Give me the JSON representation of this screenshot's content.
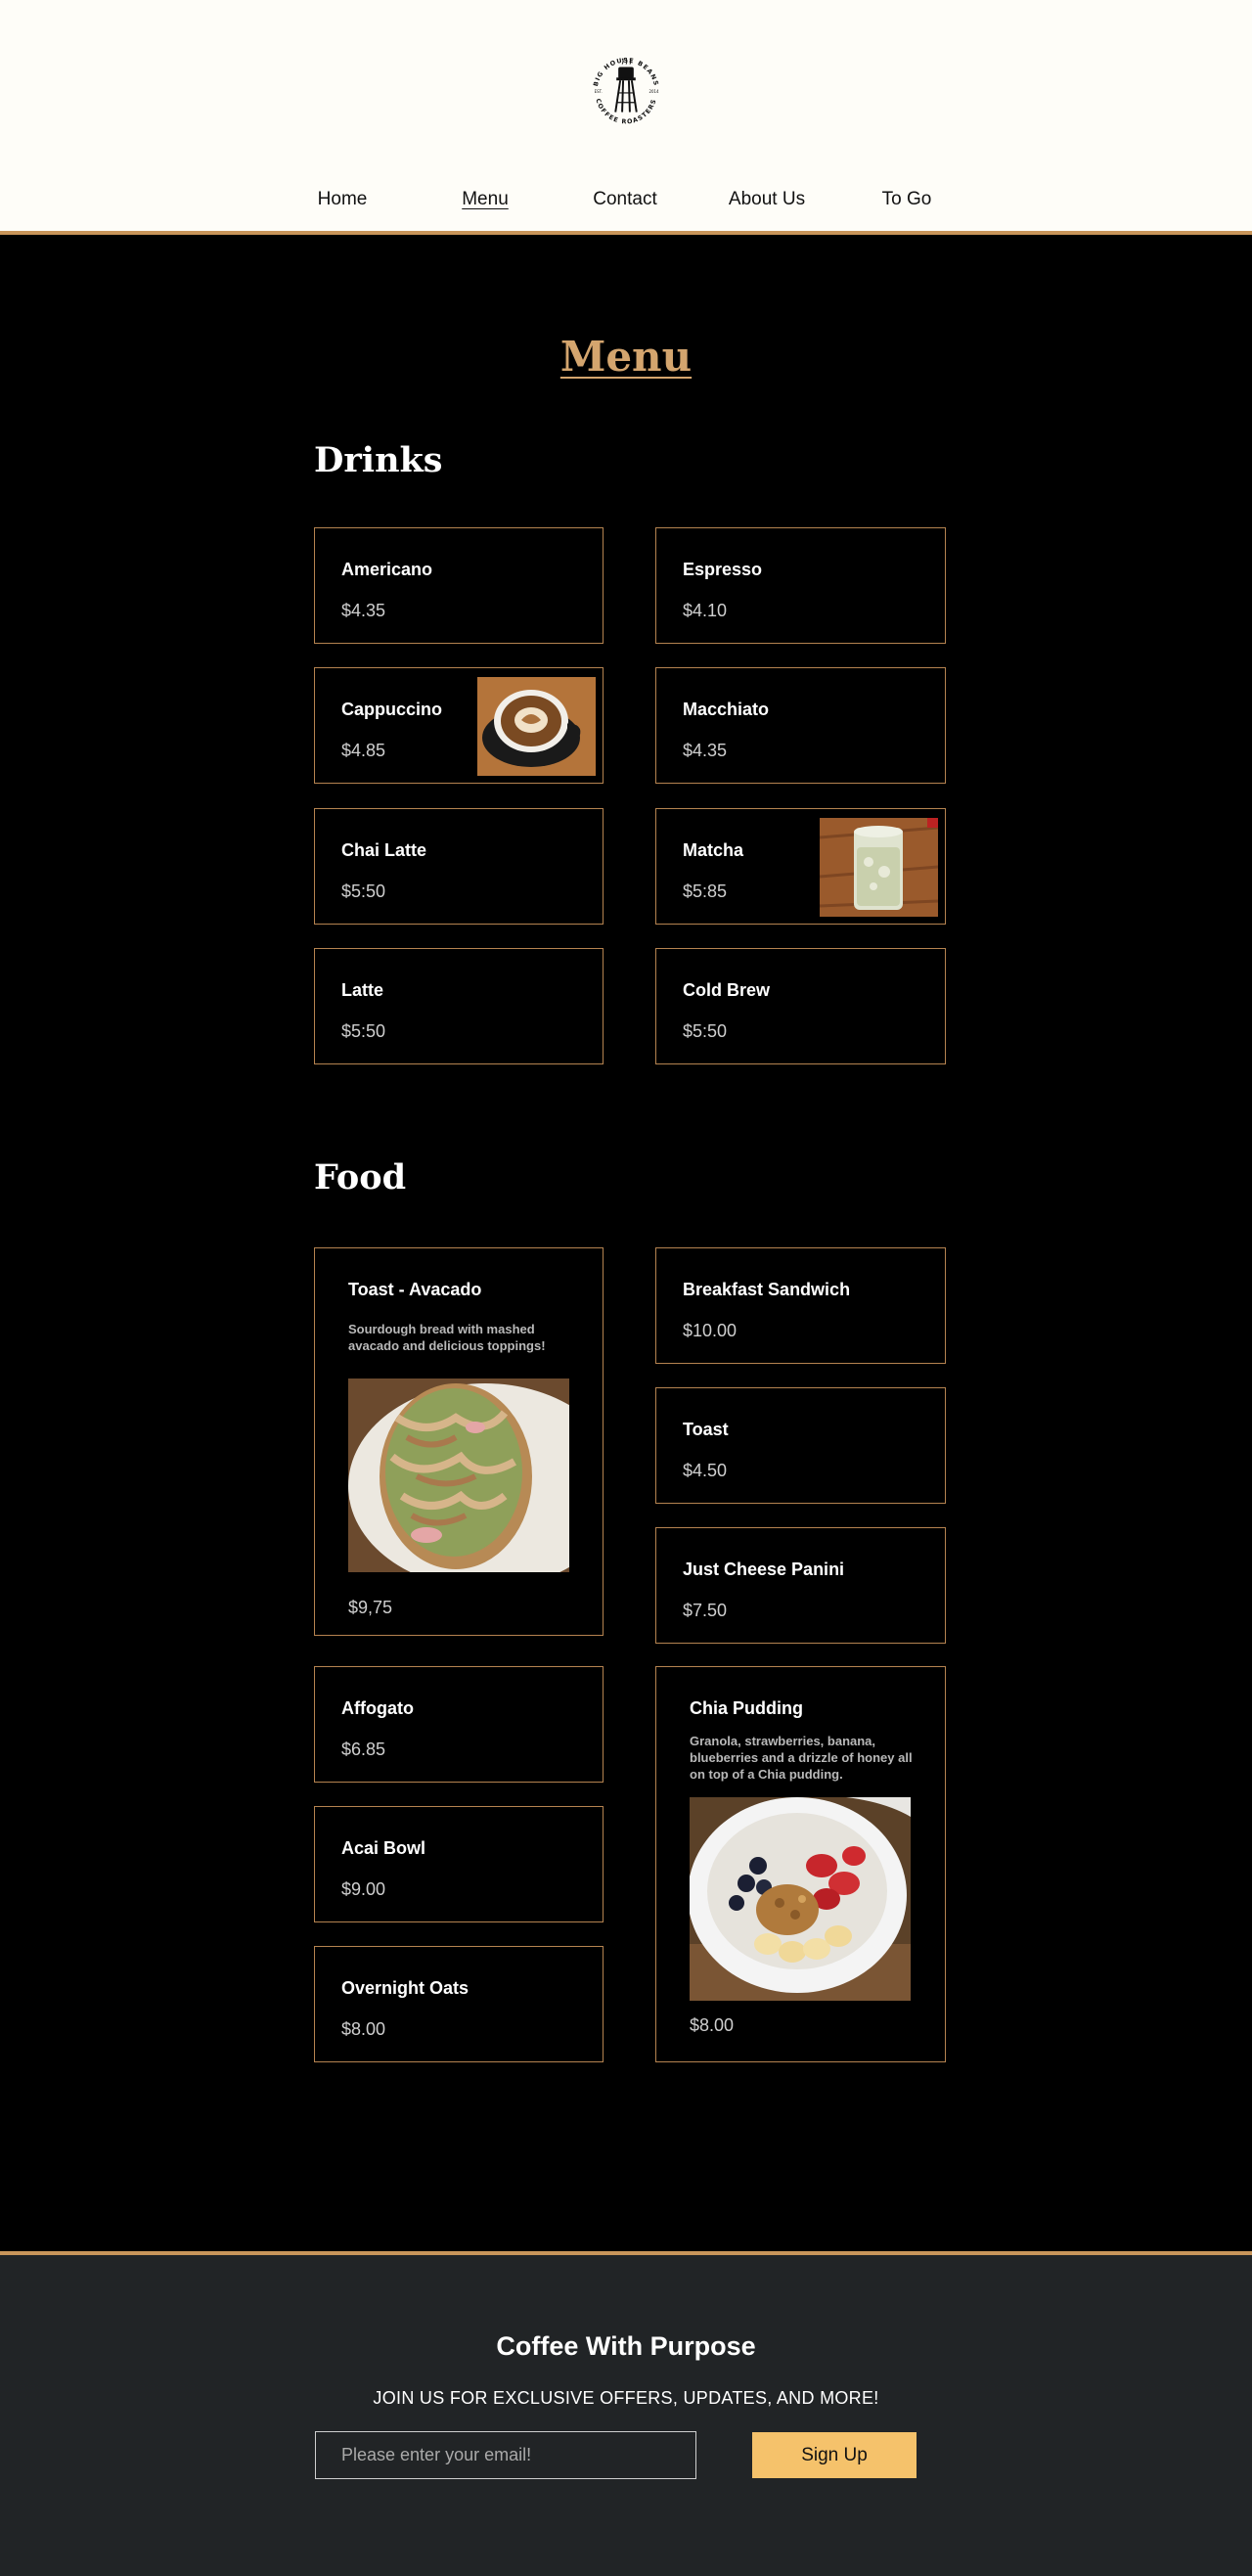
{
  "brand": {
    "logo_top_text": "BIG HOUSE BEANS",
    "logo_bottom_text": "COFFEE ROASTERS",
    "logo_est": "EST.",
    "logo_year": "2014"
  },
  "nav": {
    "items": [
      {
        "label": "Home"
      },
      {
        "label": "Menu",
        "active": true
      },
      {
        "label": "Contact"
      },
      {
        "label": "About Us"
      },
      {
        "label": "To Go"
      }
    ]
  },
  "page_title": "Menu",
  "drinks": {
    "title": "Drinks",
    "items": [
      {
        "name": "Americano",
        "price": "$4.35"
      },
      {
        "name": "Espresso",
        "price": "$4.10"
      },
      {
        "name": "Cappuccino",
        "price": "$4.85",
        "image": "cappuccino-photo"
      },
      {
        "name": "Macchiato",
        "price": "$4.35"
      },
      {
        "name": "Chai Latte",
        "price": "$5:50"
      },
      {
        "name": "Matcha",
        "price": "$5:85",
        "image": "matcha-photo"
      },
      {
        "name": "Latte",
        "price": "$5:50"
      },
      {
        "name": "Cold Brew",
        "price": "$5:50"
      }
    ]
  },
  "food": {
    "title": "Food",
    "items": [
      {
        "name": "Toast - Avacado",
        "description": "Sourdough bread with mashed avacado and delicious toppings!",
        "price": "$9,75",
        "image": "avocado-toast-photo"
      },
      {
        "name": "Breakfast Sandwich",
        "price": "$10.00"
      },
      {
        "name": "Toast",
        "price": "$4.50"
      },
      {
        "name": "Just Cheese Panini",
        "price": "$7.50"
      },
      {
        "name": "Affogato",
        "price": "$6.85"
      },
      {
        "name": "Chia Pudding",
        "description": "Granola, strawberries, banana, blueberries and a drizzle of honey all on top of a Chia pudding.",
        "price": "$8.00",
        "image": "chia-pudding-photo"
      },
      {
        "name": "Acai Bowl",
        "price": "$9.00"
      },
      {
        "name": "Overnight Oats",
        "price": "$8.00"
      }
    ]
  },
  "footer": {
    "title": "Coffee With Purpose",
    "subtitle": "JOIN US FOR EXCLUSIVE OFFERS, UPDATES, AND MORE!",
    "email_placeholder": "Please enter your email!",
    "signup_label": "Sign Up"
  },
  "colors": {
    "header_bg": "#fefdf8",
    "accent": "#c8955a",
    "page_bg": "#000000",
    "footer_bg": "#212426",
    "button": "#f5c26b"
  }
}
